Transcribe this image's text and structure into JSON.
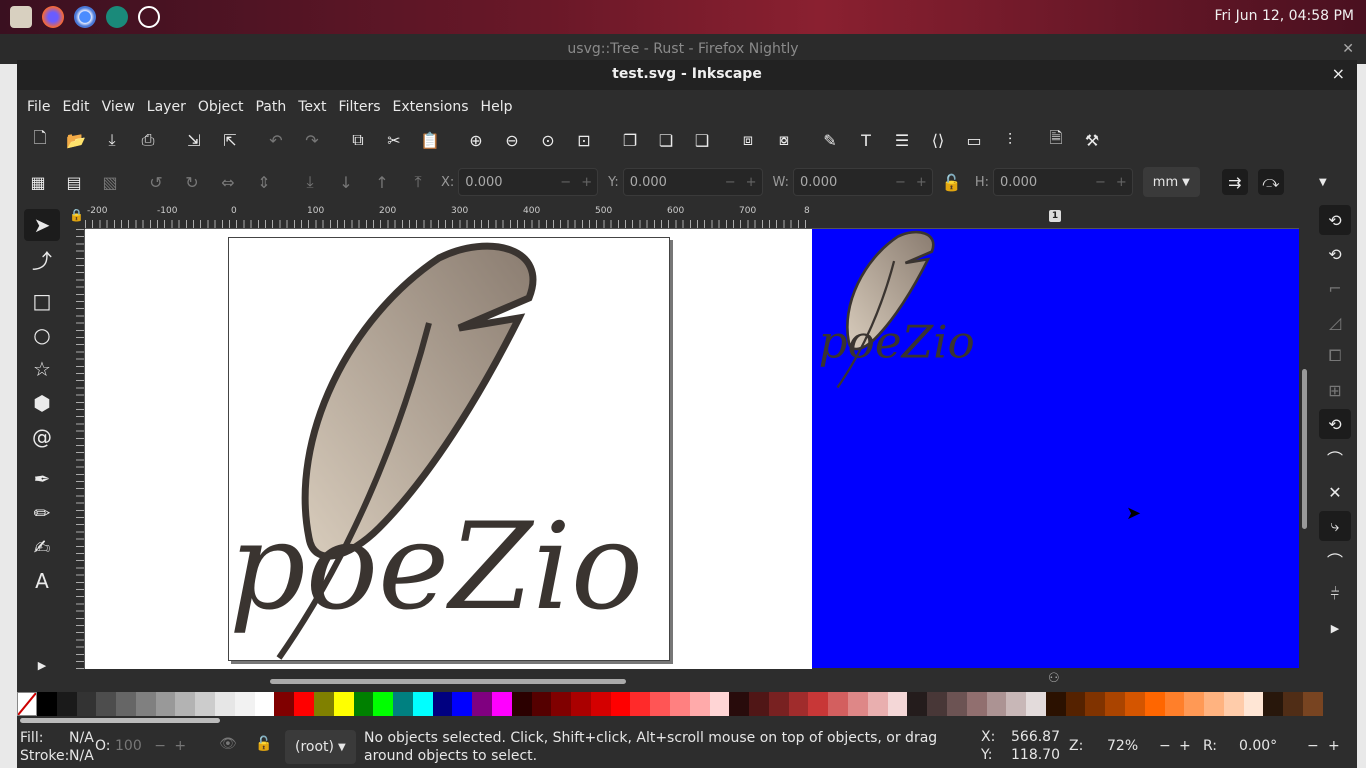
{
  "desktop": {
    "clock": "Fri Jun 12, 04:58 PM",
    "launchers": [
      "files-icon",
      "firefox-icon",
      "chromium-icon",
      "gear-icon",
      "inkscape-icon"
    ],
    "background_window_title": "usvg::Tree - Rust - Firefox Nightly"
  },
  "window": {
    "title": "test.svg - Inkscape",
    "close": "×"
  },
  "menu": [
    "File",
    "Edit",
    "View",
    "Layer",
    "Object",
    "Path",
    "Text",
    "Filters",
    "Extensions",
    "Help"
  ],
  "toolbar": {
    "x_label": "X:",
    "x_value": "0.000",
    "y_label": "Y:",
    "y_value": "0.000",
    "w_label": "W:",
    "w_value": "0.000",
    "h_label": "H:",
    "h_value": "0.000",
    "units": "mm",
    "minus": "−",
    "plus": "+"
  },
  "ruler": {
    "ticks": [
      "-200",
      "-100",
      "0",
      "100",
      "200",
      "300",
      "400",
      "500",
      "600",
      "700",
      "8"
    ]
  },
  "split_view": {
    "page_badge": "1"
  },
  "artwork": {
    "text": "poeZio"
  },
  "colors": {
    "accent_blue": "#0000ff",
    "feather_dark": "#3a3430",
    "feather_light": "#c8b8a6"
  },
  "palette": [
    "#000000",
    "#1a1a1a",
    "#333333",
    "#4d4d4d",
    "#666666",
    "#808080",
    "#999999",
    "#b3b3b3",
    "#cccccc",
    "#e6e6e6",
    "#f2f2f2",
    "#ffffff",
    "#800000",
    "#ff0000",
    "#808000",
    "#ffff00",
    "#008000",
    "#00ff00",
    "#008080",
    "#00ffff",
    "#000080",
    "#0000ff",
    "#800080",
    "#ff00ff",
    "#2b0000",
    "#550000",
    "#800000",
    "#aa0000",
    "#d40000",
    "#ff0000",
    "#ff2a2a",
    "#ff5555",
    "#ff8080",
    "#ffaaaa",
    "#ffd5d5",
    "#280b0b",
    "#501616",
    "#782121",
    "#a02c2c",
    "#c83737",
    "#d35f5f",
    "#de8787",
    "#e9afaf",
    "#f4d7d7",
    "#241c1c",
    "#483737",
    "#6c5353",
    "#916f6f",
    "#ac9393",
    "#c8b7b7",
    "#e3dbdb",
    "#2b1100",
    "#552200",
    "#803300",
    "#aa4400",
    "#d45500",
    "#ff6600",
    "#ff7f2a",
    "#ff9955",
    "#ffb380",
    "#ffccaa",
    "#ffe6d5",
    "#28170b",
    "#502d16",
    "#784421"
  ],
  "status": {
    "fill_label": "Fill:",
    "fill_value": "N/A",
    "stroke_label": "Stroke:",
    "stroke_value": "N/A",
    "opacity_label": "O:",
    "opacity_value": "100",
    "layer": "(root)",
    "message": "No objects selected. Click, Shift+click, Alt+scroll mouse on top of objects, or drag around objects to select.",
    "cursor_x_label": "X:",
    "cursor_x": "566.87",
    "cursor_y_label": "Y:",
    "cursor_y": "118.70",
    "zoom_label": "Z:",
    "zoom": "72%",
    "rotation_label": "R:",
    "rotation": "0.00°"
  }
}
